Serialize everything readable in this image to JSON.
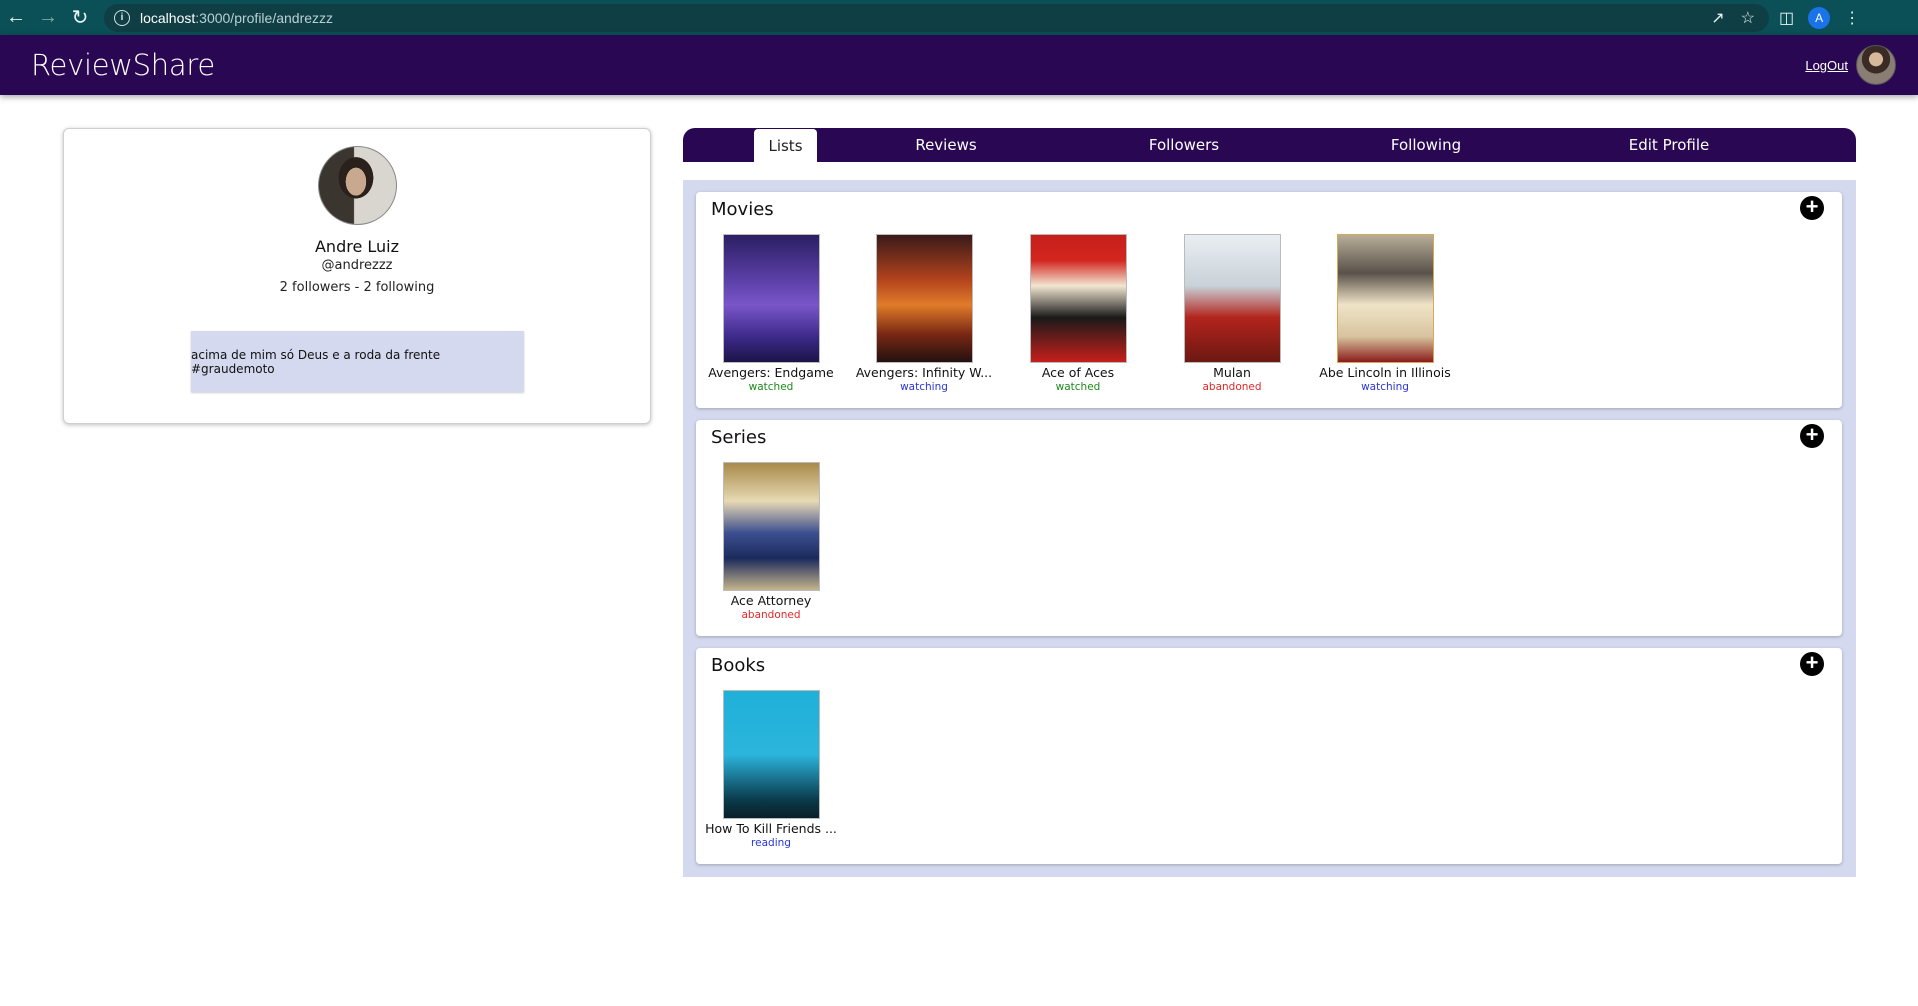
{
  "browser": {
    "url_host": "localhost",
    "url_rest": ":3000/profile/andrezzz",
    "profile_initial": "A"
  },
  "app": {
    "brand": "ReviewShare",
    "logout_label": "LogOut"
  },
  "profile": {
    "name": "Andre Luiz",
    "handle": "@andrezzz",
    "counts": "2 followers - 2 following",
    "bio": "acima de mim só Deus e a roda da frente #graudemoto"
  },
  "tabs": [
    "Lists",
    "Reviews",
    "Followers",
    "Following",
    "Edit Profile"
  ],
  "active_tab": "Lists",
  "lists": [
    {
      "title": "Movies",
      "items": [
        {
          "title": "Avengers: Endgame",
          "status": "watched"
        },
        {
          "title": "Avengers: Infinity W...",
          "status": "watching"
        },
        {
          "title": "Ace of Aces",
          "status": "watched"
        },
        {
          "title": "Mulan",
          "status": "abandoned"
        },
        {
          "title": "Abe Lincoln in Illinois",
          "status": "watching"
        }
      ]
    },
    {
      "title": "Series",
      "items": [
        {
          "title": "Ace Attorney",
          "status": "abandoned"
        }
      ]
    },
    {
      "title": "Books",
      "items": [
        {
          "title": "How To Kill Friends ...",
          "status": "reading"
        }
      ]
    }
  ],
  "status_colors": {
    "watched": "#1c8a1c",
    "watching": "#2a35d6",
    "abandoned": "#e0282a",
    "reading": "#2a35d6"
  },
  "colors": {
    "appbar": "#2a0752",
    "browser_chrome": "#0b4f57",
    "panel_bg": "#d4d9ef"
  }
}
